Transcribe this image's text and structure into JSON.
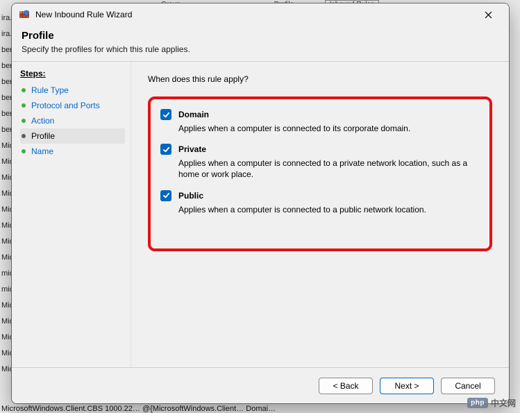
{
  "backdrop": {
    "column_headers": [
      "Group",
      "Profile",
      "Inbound Rules"
    ],
    "left_fragments": [
      "ira.S",
      "ira.S",
      "berl",
      "berl",
      "berl",
      "berl",
      "berl",
      "berl",
      "Mic",
      "Mic",
      "Mic",
      "Mic",
      "Mic",
      "Mic",
      "Mic",
      "Mic",
      "mic",
      "mic",
      "Mic",
      "Mic",
      "Mic",
      "Mic",
      "Mic"
    ],
    "status": "MicrosoftWindows.Client.CBS 1000.22…    @{MicrosoftWindows.Client…    Domai…"
  },
  "window": {
    "title": "New Inbound Rule Wizard",
    "close_tooltip": "Close"
  },
  "header": {
    "title": "Profile",
    "subtitle": "Specify the profiles for which this rule applies."
  },
  "sidebar": {
    "label": "Steps:",
    "items": [
      {
        "label": "Rule Type",
        "current": false
      },
      {
        "label": "Protocol and Ports",
        "current": false
      },
      {
        "label": "Action",
        "current": false
      },
      {
        "label": "Profile",
        "current": true
      },
      {
        "label": "Name",
        "current": false
      }
    ]
  },
  "main": {
    "question": "When does this rule apply?",
    "options": [
      {
        "key": "domain",
        "label": "Domain",
        "checked": true,
        "description": "Applies when a computer is connected to its corporate domain."
      },
      {
        "key": "private",
        "label": "Private",
        "checked": true,
        "description": "Applies when a computer is connected to a private network location, such as a home or work place."
      },
      {
        "key": "public",
        "label": "Public",
        "checked": true,
        "description": "Applies when a computer is connected to a public network location."
      }
    ]
  },
  "footer": {
    "back": "< Back",
    "next": "Next >",
    "cancel": "Cancel"
  },
  "watermark": {
    "badge": "php",
    "text": "中文网"
  }
}
